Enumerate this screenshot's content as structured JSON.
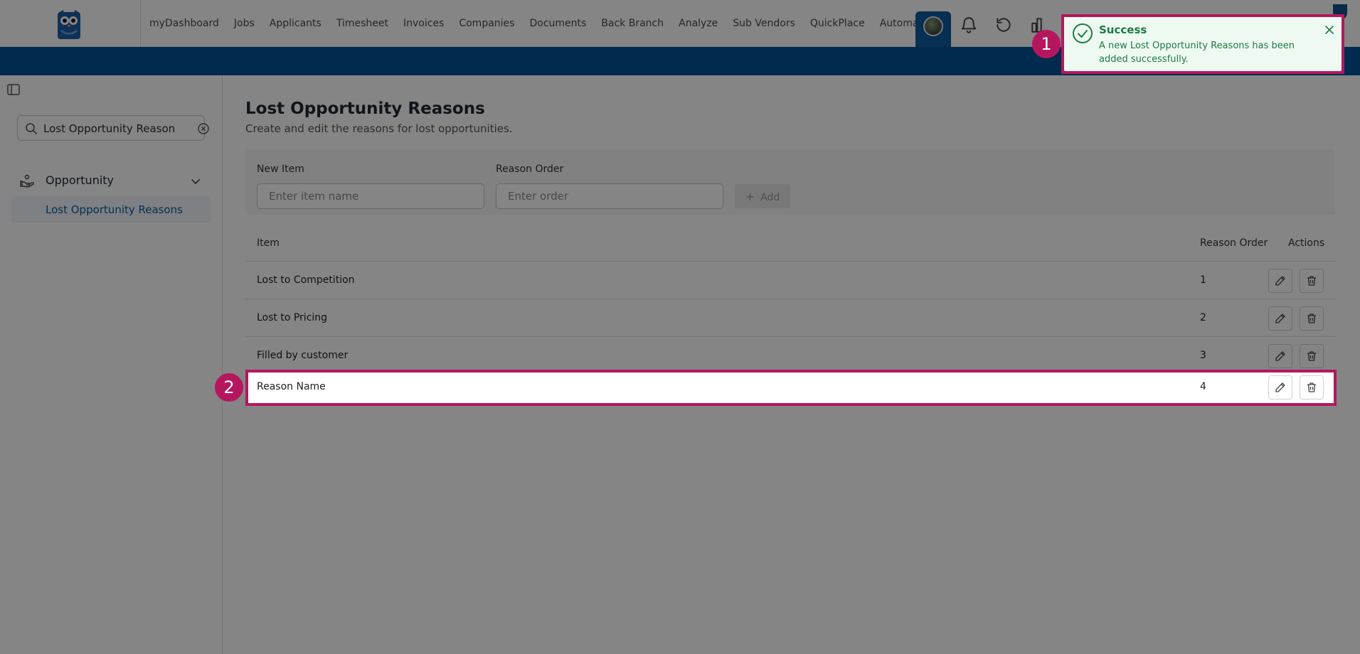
{
  "nav": {
    "items": [
      "myDashboard",
      "Jobs",
      "Applicants",
      "Timesheet",
      "Invoices",
      "Companies",
      "Documents",
      "Back Branch",
      "Analyze",
      "Sub Vendors",
      "QuickPlace",
      "Automation"
    ]
  },
  "sidebar": {
    "search_value": "Lost Opportunity Reason",
    "group_label": "Opportunity",
    "sub_item_label": "Lost Opportunity Reasons"
  },
  "main": {
    "title": "Lost Opportunity Reasons",
    "subtitle": "Create and edit the reasons for lost opportunities.",
    "form": {
      "item_label": "New Item",
      "item_placeholder": "Enter item name",
      "order_label": "Reason Order",
      "order_placeholder": "Enter order",
      "add_label": "Add"
    },
    "table": {
      "headers": {
        "item": "Item",
        "order": "Reason Order",
        "actions": "Actions"
      },
      "rows": [
        {
          "item": "Lost to Competition",
          "order": "1"
        },
        {
          "item": "Lost to Pricing",
          "order": "2"
        },
        {
          "item": "Filled by customer",
          "order": "3"
        },
        {
          "item": "Reason Name",
          "order": "4"
        }
      ]
    }
  },
  "toast": {
    "title": "Success",
    "message": "A new Lost Opportunity Reasons has been added successfully."
  },
  "annotations": {
    "toast_badge": "1",
    "row_badge": "2"
  },
  "colors": {
    "brand_blue": "#005497",
    "highlight": "#b5175e",
    "success_green": "#1d7a45"
  },
  "icons": [
    "owl-logo-icon",
    "bell-icon",
    "refresh-icon",
    "chart-icon",
    "sidebar-toggle-icon",
    "search-icon",
    "clear-icon",
    "opportunity-icon",
    "chevron-down-icon",
    "plus-icon",
    "pencil-icon",
    "trash-icon",
    "check-circle-icon",
    "close-icon"
  ]
}
